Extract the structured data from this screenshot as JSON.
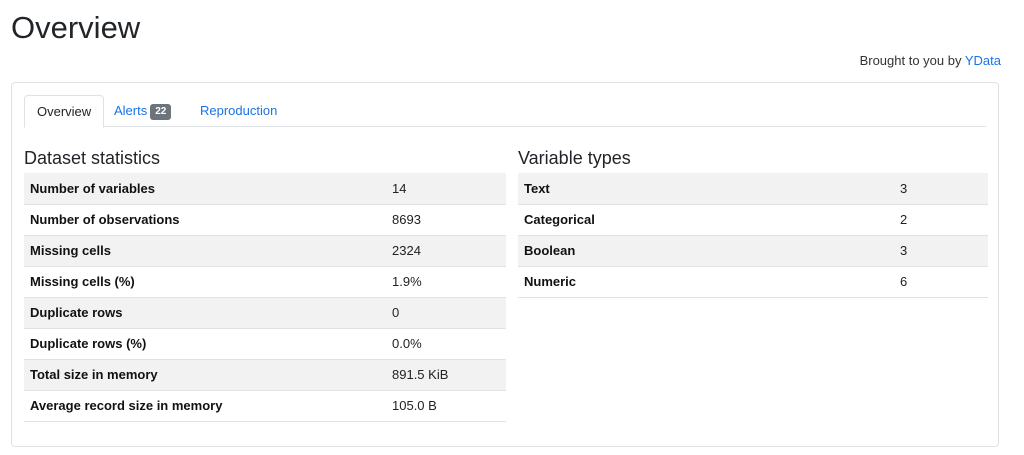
{
  "page": {
    "title": "Overview",
    "brought_prefix": "Brought to you by",
    "brought_link": "YData"
  },
  "tabs": [
    {
      "label": "Overview",
      "active": true
    },
    {
      "label": "Alerts",
      "badge": "22"
    },
    {
      "label": "Reproduction"
    }
  ],
  "dataset_statistics": {
    "title": "Dataset statistics",
    "rows": [
      {
        "label": "Number of variables",
        "value": "14"
      },
      {
        "label": "Number of observations",
        "value": "8693"
      },
      {
        "label": "Missing cells",
        "value": "2324"
      },
      {
        "label": "Missing cells (%)",
        "value": "1.9%"
      },
      {
        "label": "Duplicate rows",
        "value": "0"
      },
      {
        "label": "Duplicate rows (%)",
        "value": "0.0%"
      },
      {
        "label": "Total size in memory",
        "value": "891.5 KiB"
      },
      {
        "label": "Average record size in memory",
        "value": "105.0 B"
      }
    ]
  },
  "variable_types": {
    "title": "Variable types",
    "rows": [
      {
        "label": "Text",
        "value": "3"
      },
      {
        "label": "Categorical",
        "value": "2"
      },
      {
        "label": "Boolean",
        "value": "3"
      },
      {
        "label": "Numeric",
        "value": "6"
      }
    ]
  },
  "colors": {
    "link": "#1a73e8",
    "stripe": "#f2f2f2",
    "border": "#dee2e6",
    "badge": "#6c757d"
  }
}
